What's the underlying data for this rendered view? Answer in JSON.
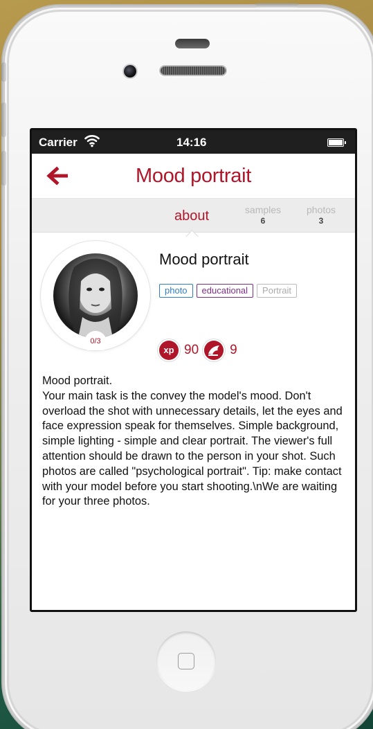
{
  "status_bar": {
    "carrier": "Carrier",
    "time": "14:16"
  },
  "nav": {
    "title": "Mood portrait"
  },
  "tabs": [
    {
      "label": "about",
      "active": true
    },
    {
      "label": "samples",
      "count": "6"
    },
    {
      "label": "photos",
      "count": "3"
    }
  ],
  "task": {
    "avatar_progress": "0/3",
    "title": "Mood portrait",
    "tags": [
      "photo",
      "educational",
      "Portrait"
    ],
    "xp_label": "xp",
    "xp_value": "90",
    "points_value": "9",
    "description": "Mood portrait.\nYour main task is the convey the model's mood. Don't overload the shot with unnecessary details, let the eyes and face expression speak for themselves. Simple background, simple lighting - simple and clear portrait. The viewer's full attention should be drawn to the person in your shot. Such photos are called \"psychological portrait\". Tip: make contact with your model before you start shooting.\\nWe are waiting for your three photos."
  },
  "colors": {
    "accent": "#b0162a",
    "tag_photo": "#2f7fc7",
    "tag_educational": "#7d2f87",
    "tag_portrait": "#aaaaaa"
  }
}
